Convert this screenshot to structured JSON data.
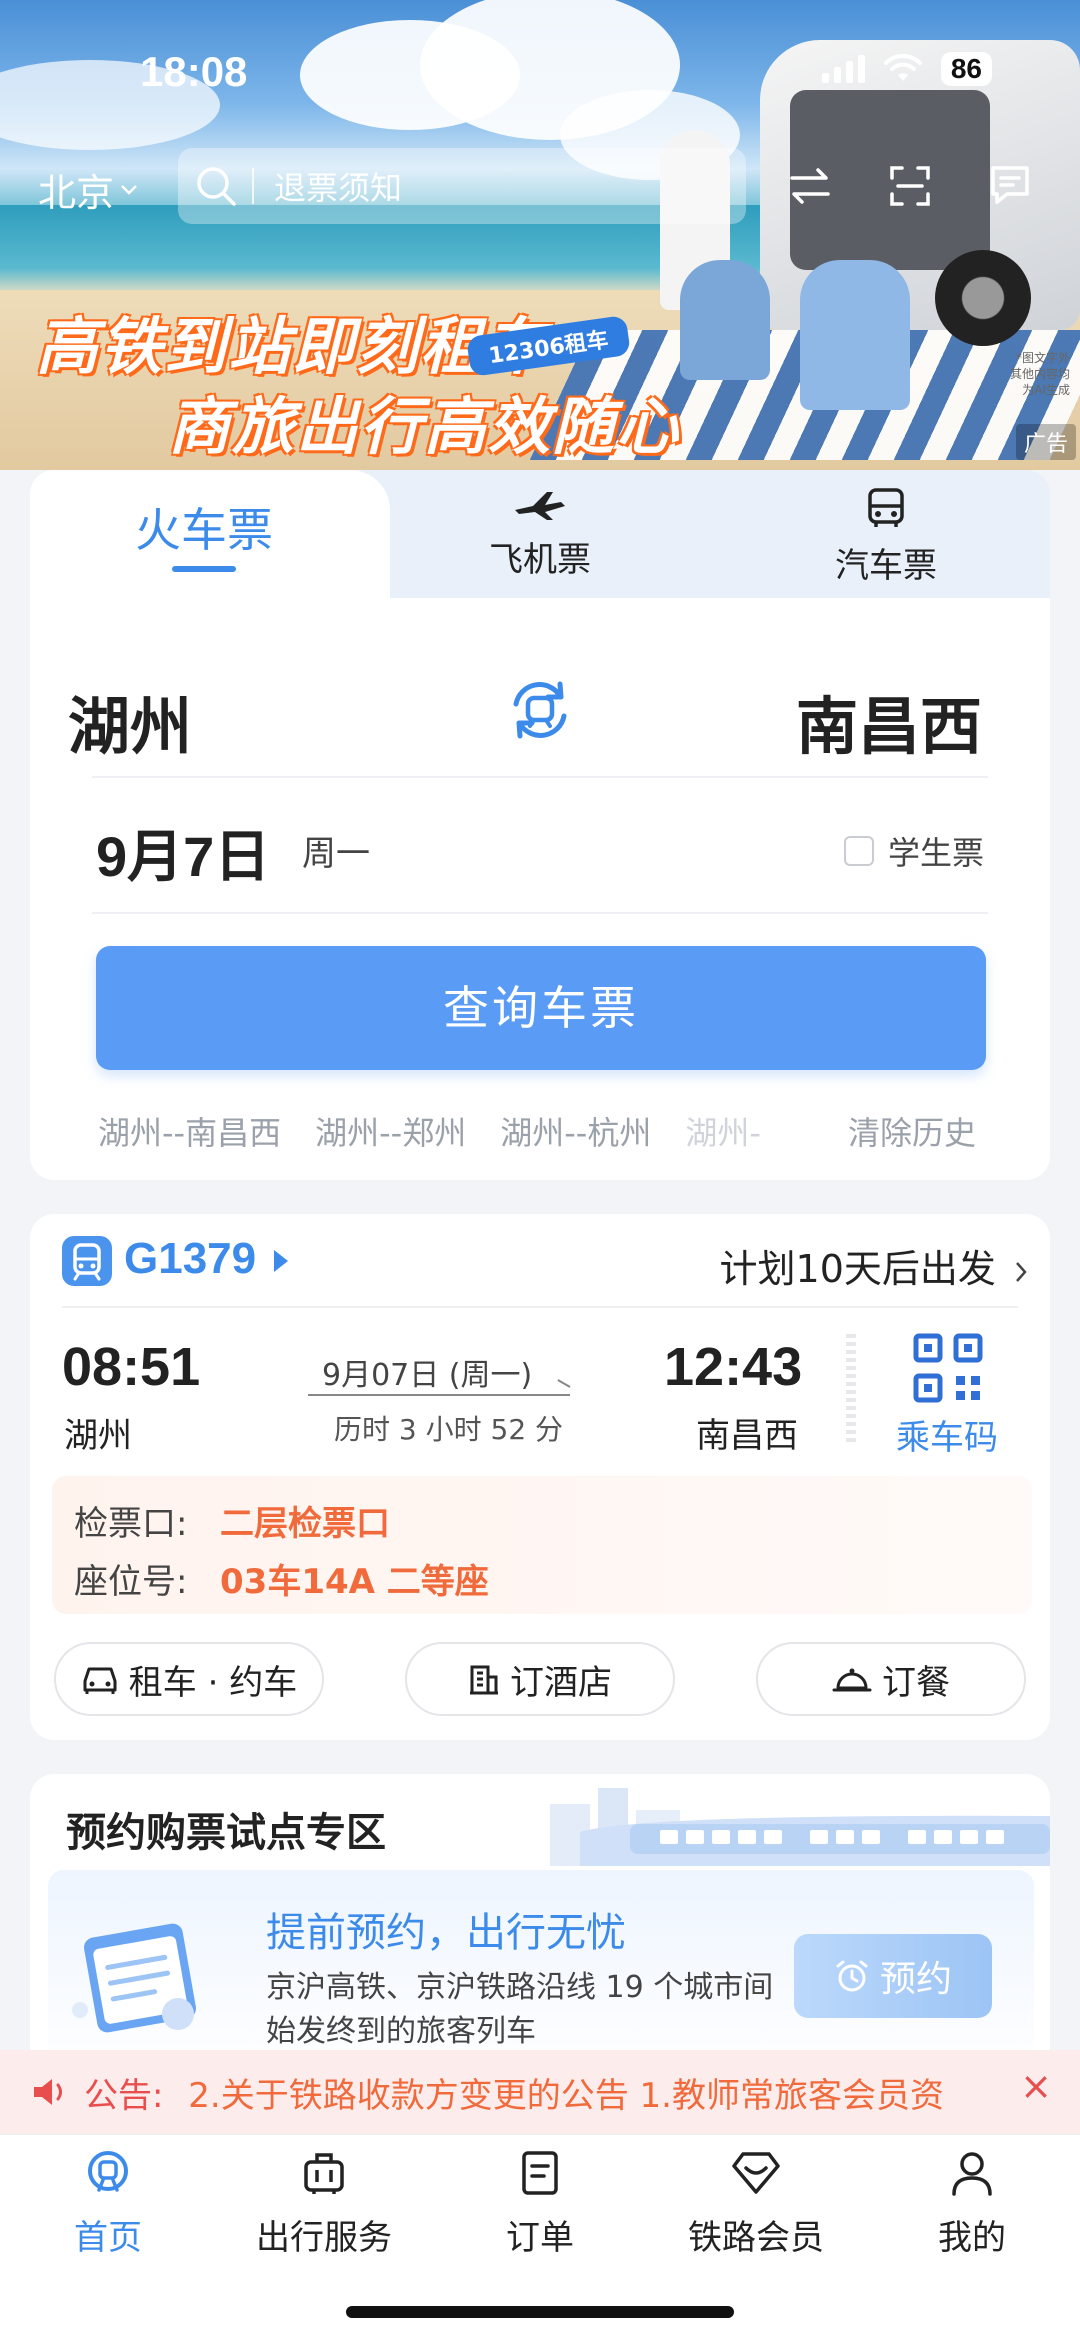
{
  "status": {
    "time": "18:08",
    "battery": "86"
  },
  "header": {
    "city": "北京",
    "search_placeholder": "退票须知"
  },
  "banner": {
    "slogan_line1": "高铁到站即刻租车",
    "slogan_line2": "商旅出行高效随心",
    "tag": "12306租车",
    "note": "*图文字外 其他内容均为AI生成",
    "ad_label": "广告"
  },
  "tabs": {
    "train": "火车票",
    "flight": "飞机票",
    "bus": "汽车票"
  },
  "search": {
    "from": "湖州",
    "to": "南昌西",
    "date": "9月7日",
    "weekday": "周一",
    "student_label": "学生票",
    "query_button": "查询车票",
    "history": [
      "湖州--南昌西",
      "湖州--郑州",
      "湖州--杭州",
      "湖州-"
    ],
    "clear_history": "清除历史"
  },
  "trip": {
    "train_no": "G1379",
    "plan": "计划10天后出发",
    "dep_time": "08:51",
    "dep_station": "湖州",
    "arr_time": "12:43",
    "arr_station": "南昌西",
    "date": "9月07日 (周一)",
    "duration": "历时 3 小时 52 分",
    "qr_label": "乘车码",
    "gate_label": "检票口:",
    "gate_value": "二层检票口",
    "seat_label": "座位号:",
    "seat_value": "03车14A 二等座",
    "actions": [
      "租车 · 约车",
      "订酒店",
      "订餐"
    ]
  },
  "reservation": {
    "title": "预约购票试点专区",
    "subtitle": "提前预约，出行无忧",
    "desc": "京沪高铁、京沪铁路沿线 19 个城市间始发终到的旅客列车",
    "button": "预约"
  },
  "notice": {
    "prefix": "公告:",
    "text": "2.关于铁路收款方变更的公告    1.教师常旅客会员资"
  },
  "nav": [
    "首页",
    "出行服务",
    "订单",
    "铁路会员",
    "我的"
  ],
  "colors": {
    "accent": "#3c8bea",
    "button": "#5a9bf5",
    "warning": "#f06a3c",
    "notice": "#e94e4e"
  }
}
